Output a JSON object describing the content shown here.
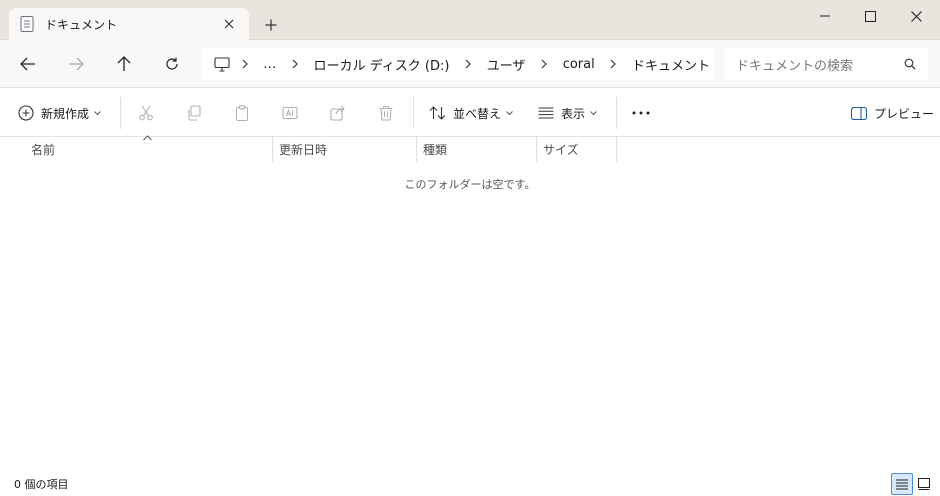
{
  "tab": {
    "title": "ドキュメント",
    "icon": "document-folder-icon"
  },
  "breadcrumb": [
    "ローカル ディスク (D:)",
    "ユーザ",
    "coral",
    "ドキュメント"
  ],
  "breadcrumb_more": "…",
  "search": {
    "placeholder": "ドキュメントの検索"
  },
  "toolbar": {
    "new_label": "新規作成",
    "sort_label": "並べ替え",
    "view_label": "表示",
    "preview_label": "プレビュー"
  },
  "columns": {
    "name": "名前",
    "date": "更新日時",
    "type": "種類",
    "size": "サイズ"
  },
  "empty_message": "このフォルダーは空です。",
  "status": {
    "count": "0 個の項目"
  },
  "colors": {
    "titlebar": "#e8e4de",
    "navbar": "#f9f8f6",
    "accent": "#4a8fd0"
  }
}
